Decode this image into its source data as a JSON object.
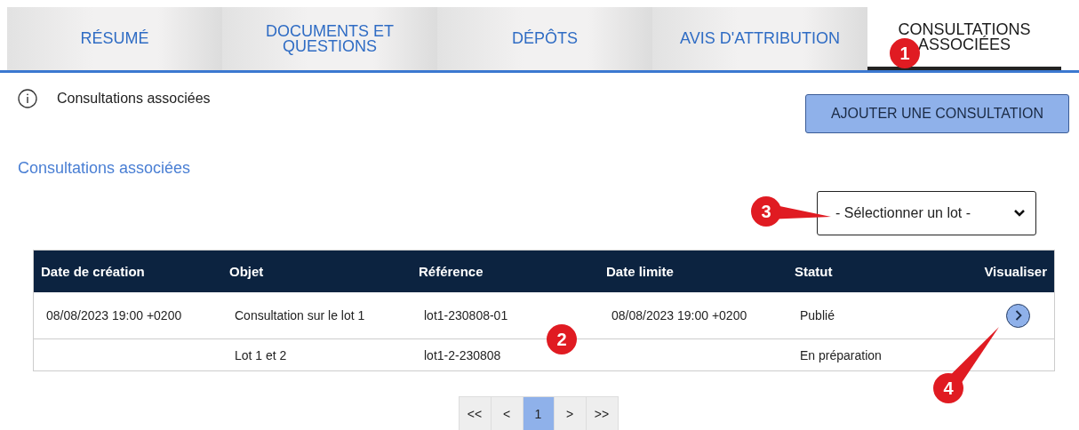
{
  "tabs": [
    {
      "label": "RÉSUMÉ",
      "selected": false
    },
    {
      "label": "DOCUMENTS ET QUESTIONS",
      "selected": false
    },
    {
      "label": "DÉPÔTS",
      "selected": false
    },
    {
      "label": "AVIS D'ATTRIBUTION",
      "selected": false
    },
    {
      "label": "CONSULTATIONS ASSOCIÉES",
      "selected": true
    }
  ],
  "info": {
    "text": "Consultations associées"
  },
  "add_button": "AJOUTER UNE CONSULTATION",
  "section_title": "Consultations associées",
  "lot_select": {
    "value": "- Sélectionner un lot -"
  },
  "table": {
    "columns": [
      "Date de création",
      "Objet",
      "Référence",
      "Date limite",
      "Statut",
      "Visualiser"
    ],
    "rows": [
      {
        "cells": [
          "08/08/2023 19:00 +0200",
          "Consultation sur le lot 1",
          "lot1-230808-01",
          "08/08/2023 19:00 +0200",
          "Publié"
        ],
        "view": true
      },
      {
        "cells": [
          "",
          "Lot 1 et 2",
          "lot1-2-230808",
          "",
          "En préparation"
        ],
        "view": false
      }
    ]
  },
  "pagination": [
    {
      "label": "<<",
      "selected": false
    },
    {
      "label": "<",
      "selected": false
    },
    {
      "label": "1",
      "selected": true
    },
    {
      "label": ">",
      "selected": false
    },
    {
      "label": ">>",
      "selected": false
    }
  ],
  "callouts": [
    "1",
    "2",
    "3",
    "4"
  ]
}
